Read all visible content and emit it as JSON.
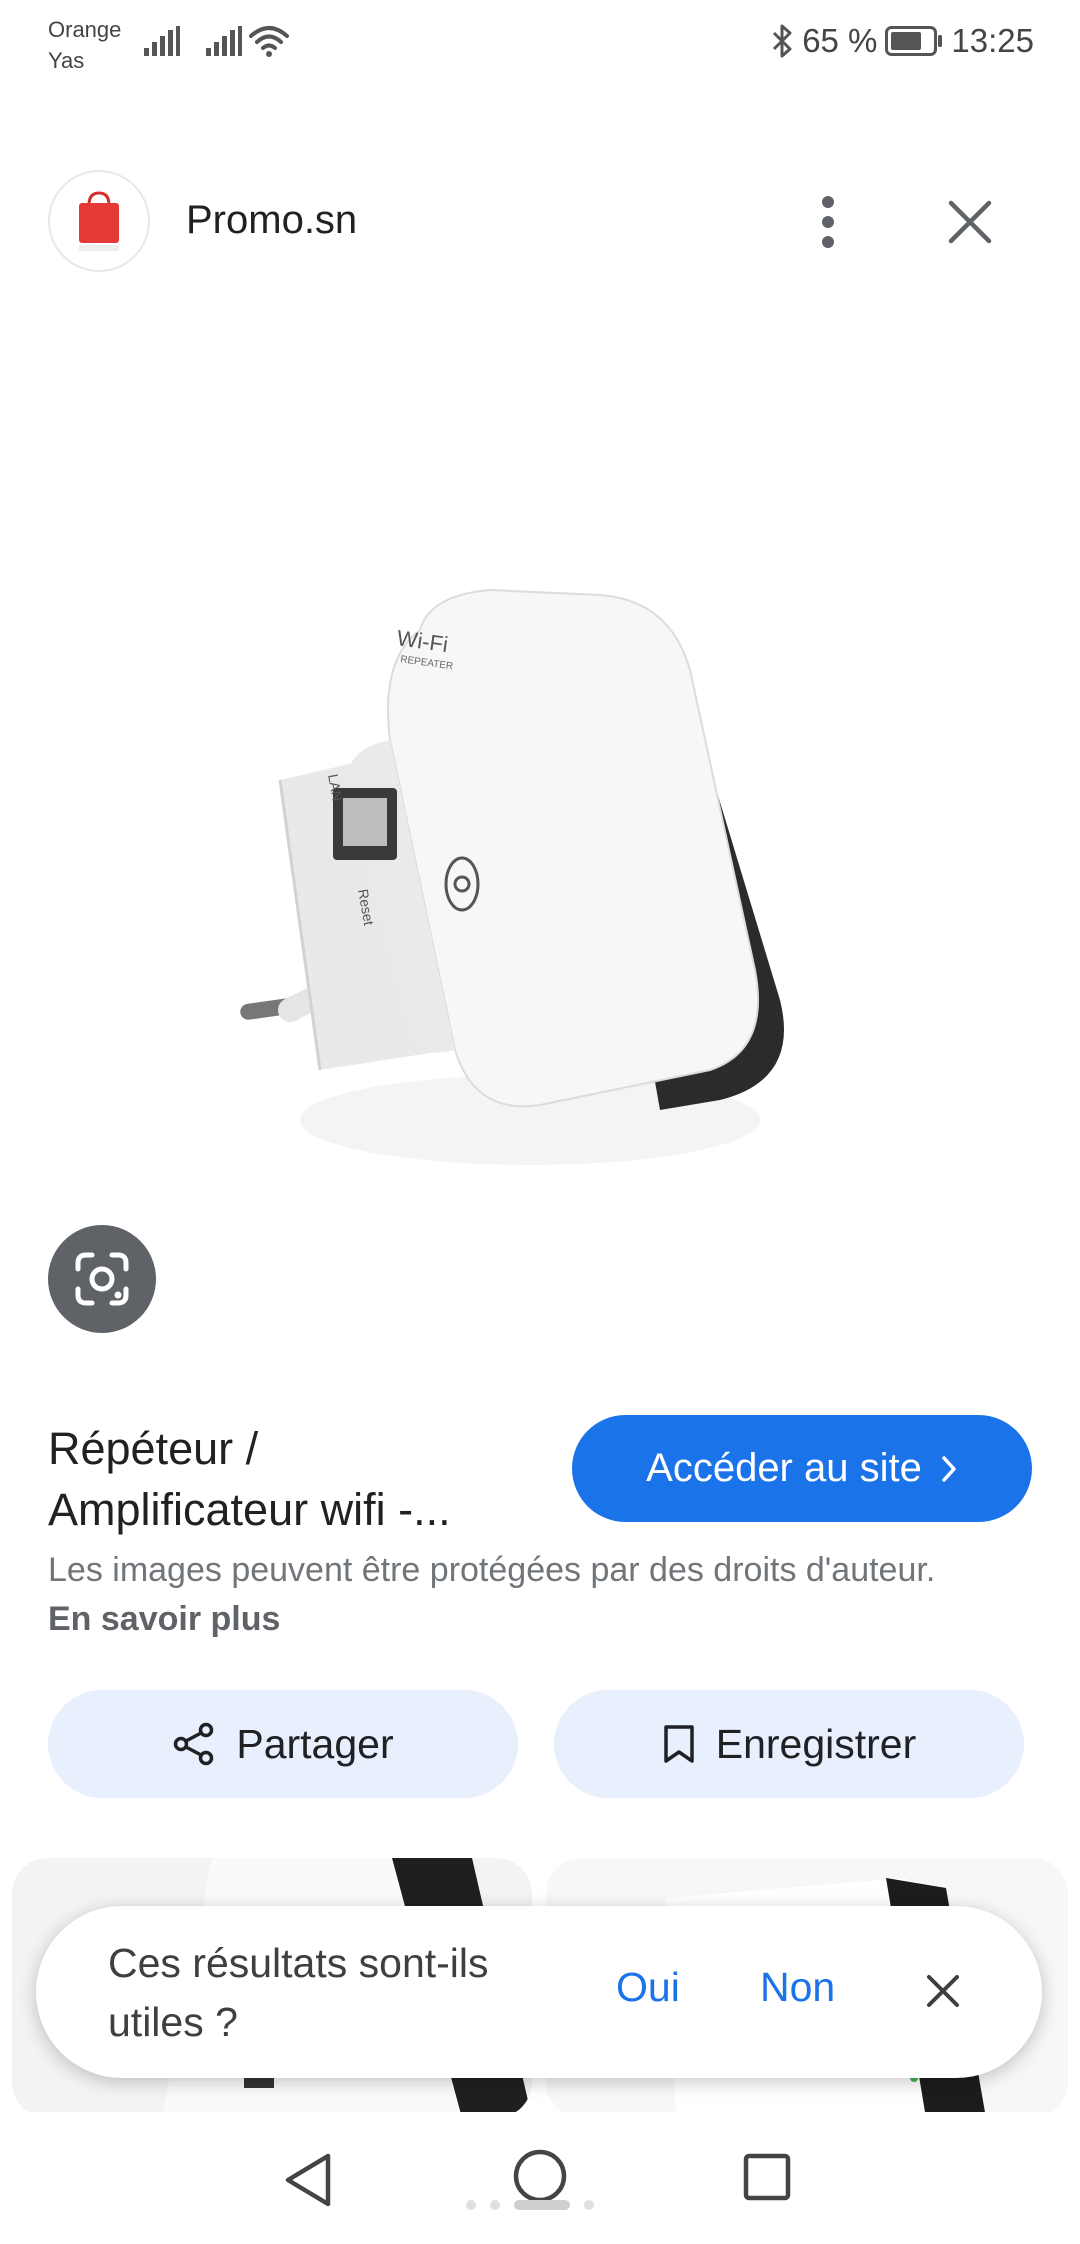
{
  "status_bar": {
    "carrier_line1": "Orange",
    "carrier_line2": "Yas",
    "battery": "65 %",
    "time": "13:25"
  },
  "header": {
    "site_name": "Promo.sn",
    "icons": [
      "site-logo-icon",
      "more-vert-icon",
      "close-icon"
    ]
  },
  "image": {
    "product_text_wifi": "Wi-Fi",
    "product_text_repeater": "REPEATER",
    "product_text_lan": "LAN",
    "product_text_reset": "Reset",
    "lens_icon": "google-lens-icon"
  },
  "info": {
    "title": "Répéteur / Amplificateur wifi -...",
    "visit_label": "Accéder au site",
    "copyright_text": "Les images peuvent être protégées par des droits d'auteur.",
    "learn_more": "En savoir plus",
    "share_label": "Partager",
    "save_label": "Enregistrer"
  },
  "feedback": {
    "question": "Ces résultats sont-ils utiles ?",
    "yes_label": "Oui",
    "no_label": "Non"
  },
  "colors": {
    "accent": "#1a73e8",
    "chip_bg": "#e8f0fe",
    "text_primary": "#202124",
    "text_secondary": "#70757a"
  }
}
